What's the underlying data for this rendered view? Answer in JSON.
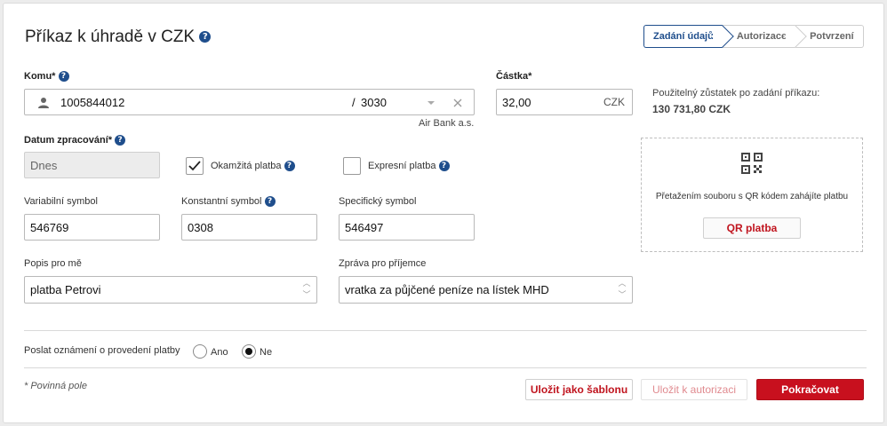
{
  "header": {
    "title": "Příkaz k úhradě v CZK",
    "help_glyph": "?"
  },
  "steps": {
    "step1": "Zadání údajů",
    "step2": "Autorizace",
    "step3": "Potvrzení"
  },
  "recipient": {
    "label": "Komu*",
    "account_number": "1005844012",
    "separator": "/",
    "bank_code": "3030",
    "bank_name": "Air Bank a.s."
  },
  "amount": {
    "label": "Částka*",
    "value": "32,00",
    "currency": "CZK"
  },
  "balance": {
    "label": "Použitelný zůstatek po zadání příkazu:",
    "value": "130 731,80 CZK"
  },
  "processing_date": {
    "label": "Datum zpracování*",
    "value": "Dnes"
  },
  "options": {
    "instant": {
      "label": "Okamžitá platba",
      "checked": true
    },
    "express": {
      "label": "Expresní platba",
      "checked": false
    }
  },
  "symbols": {
    "variable": {
      "label": "Variabilní symbol",
      "value": "546769"
    },
    "constant": {
      "label": "Konstantní symbol",
      "value": "0308"
    },
    "specific": {
      "label": "Specifický symbol",
      "value": "546497"
    }
  },
  "notes": {
    "my_description": {
      "label": "Popis pro mě",
      "value": "platba Petrovi"
    },
    "recipient_message": {
      "label": "Zpráva pro příjemce",
      "value": "vratka za půjčené peníze na lístek MHD"
    }
  },
  "qr": {
    "hint": "Přetažením souboru s QR kódem zahájíte platbu",
    "button": "QR platba"
  },
  "notification": {
    "label": "Poslat oznámení o provedení platby",
    "yes": "Ano",
    "no": "Ne",
    "selected": "Ne"
  },
  "footer": {
    "required_note": "* Povinná pole",
    "save_template": "Uložit jako šablonu",
    "save_for_auth": "Uložit k autorizaci",
    "continue": "Pokračovat"
  },
  "colors": {
    "brand_red": "#c8101e",
    "link_blue": "#1f4e8c"
  }
}
